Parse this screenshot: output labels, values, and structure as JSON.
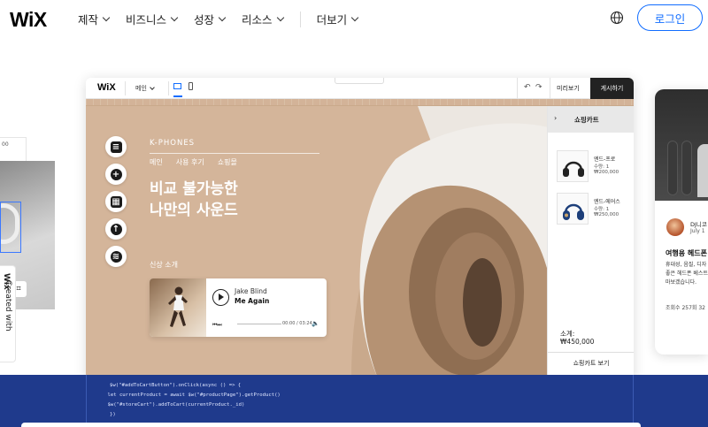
{
  "nav": {
    "logo": "WiX",
    "items": [
      {
        "label": "제작"
      },
      {
        "label": "비즈니스"
      },
      {
        "label": "성장"
      },
      {
        "label": "리소스"
      },
      {
        "label": "더보기"
      }
    ],
    "login": "로그인"
  },
  "left_panel": {
    "strip_text": "00",
    "badge_prefix": "Created with ",
    "badge_brand": "Wix"
  },
  "editor": {
    "logo": "WiX",
    "page_selector": "메인",
    "tab_caret": "^",
    "undo": "↶",
    "redo": "↷",
    "preview": "미리보기",
    "publish": "게시하기"
  },
  "site": {
    "brand": "K-PHONES",
    "menu": [
      "메인",
      "사용 후기",
      "쇼핑몰"
    ],
    "headline_1": "비교 불가능한",
    "headline_2": "나만의 사운드",
    "new_intro": "신상 소개",
    "player": {
      "artist": "Jake Blind",
      "song": "Me Again",
      "controls": "⏮ ⏭",
      "time": "00:00 / 03:24",
      "volume": "🔈",
      "progress": 0.0
    }
  },
  "cart": {
    "back": "›",
    "title": "쇼핑카트",
    "items": [
      {
        "name": "엔드-프로",
        "qty": "수량: 1",
        "price": "₩200,000"
      },
      {
        "name": "엔드-에어스",
        "qty": "수량: 1",
        "price": "₩250,000"
      }
    ],
    "subtotal_label": "소계:",
    "subtotal": "₩450,000",
    "view_cart": "쇼핑카트 보기"
  },
  "code": [
    "$w(\"#addToCartButton\").onClick(async () => {",
    "    let currentProduct = await $w(\"#productPage\").getProduct()",
    "    $w(\"#storeCart\").addToCart(currentProduct._id)",
    "})"
  ],
  "blog": {
    "author": "DJ니코",
    "date": "July 1",
    "title": "여행용 헤드폰",
    "lines": [
      "휴대성, 음질, 디자",
      "좋은 헤드폰 베스트",
      "마보겠습니다."
    ],
    "meta": "조회수 257회   32"
  },
  "colors": {
    "accent": "#116dff",
    "site_bg": "#d4b59a",
    "code_bg": "#1f3a8c",
    "publish_bg": "#222222"
  },
  "icons": {
    "globe": "globe-icon",
    "tools": [
      "pages-icon",
      "add-icon",
      "apps-icon",
      "upload-icon",
      "database-icon"
    ]
  }
}
